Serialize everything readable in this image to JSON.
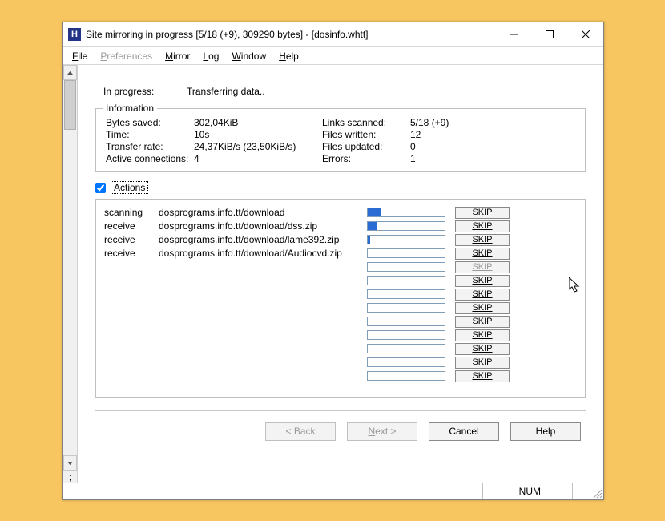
{
  "window": {
    "title": "Site mirroring in progress [5/18 (+9), 309290 bytes] - [dosinfo.whtt]",
    "app_icon_letter": "H"
  },
  "menu": {
    "file": "File",
    "preferences": "Preferences",
    "mirror": "Mirror",
    "log": "Log",
    "window": "Window",
    "help": "Help"
  },
  "progress": {
    "label": "In progress:",
    "status": "Transferring data.."
  },
  "info": {
    "legend": "Information",
    "labels": {
      "bytes_saved": "Bytes saved:",
      "time": "Time:",
      "transfer_rate": "Transfer rate:",
      "active_connections": "Active connections:",
      "links_scanned": "Links scanned:",
      "files_written": "Files written:",
      "files_updated": "Files updated:",
      "errors": "Errors:"
    },
    "values": {
      "bytes_saved": "302,04KiB",
      "time": "10s",
      "transfer_rate": "24,37KiB/s (23,50KiB/s)",
      "active_connections": "4",
      "links_scanned": "5/18 (+9)",
      "files_written": "12",
      "files_updated": "0",
      "errors": "1"
    }
  },
  "actions": {
    "checkbox_label": "Actions",
    "skip_label": "SKIP",
    "rows": [
      {
        "action": "scanning",
        "url": "dosprograms.info.tt/download",
        "progress_pct": 18,
        "skip_active": true
      },
      {
        "action": "receive",
        "url": "dosprograms.info.tt/download/dss.zip",
        "progress_pct": 12,
        "skip_active": true
      },
      {
        "action": "receive",
        "url": "dosprograms.info.tt/download/lame392.zip",
        "progress_pct": 3,
        "skip_active": true
      },
      {
        "action": "receive",
        "url": "dosprograms.info.tt/download/Audiocvd.zip",
        "progress_pct": 0,
        "skip_active": true
      },
      {
        "action": "",
        "url": "",
        "progress_pct": 0,
        "skip_active": false
      },
      {
        "action": "",
        "url": "",
        "progress_pct": 0,
        "skip_active": true
      },
      {
        "action": "",
        "url": "",
        "progress_pct": 0,
        "skip_active": true
      },
      {
        "action": "",
        "url": "",
        "progress_pct": 0,
        "skip_active": true
      },
      {
        "action": "",
        "url": "",
        "progress_pct": 0,
        "skip_active": true
      },
      {
        "action": "",
        "url": "",
        "progress_pct": 0,
        "skip_active": true
      },
      {
        "action": "",
        "url": "",
        "progress_pct": 0,
        "skip_active": true
      },
      {
        "action": "",
        "url": "",
        "progress_pct": 0,
        "skip_active": true
      },
      {
        "action": "",
        "url": "",
        "progress_pct": 0,
        "skip_active": true
      }
    ]
  },
  "wizard": {
    "back": "< Back",
    "next": "Next >",
    "cancel": "Cancel",
    "help": "Help"
  },
  "statusbar": {
    "num": "NUM"
  }
}
